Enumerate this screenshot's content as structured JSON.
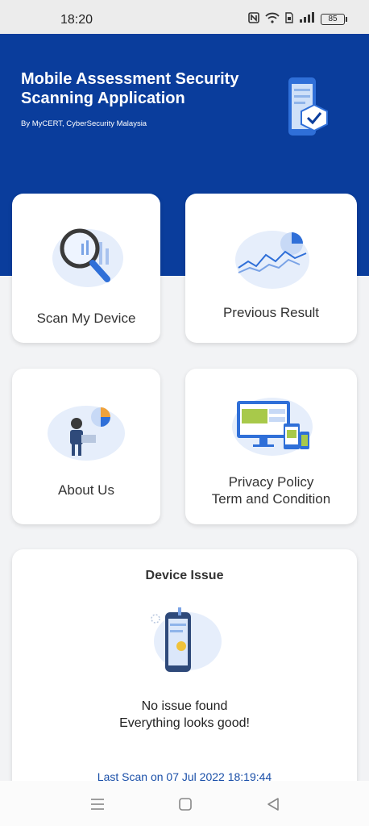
{
  "status_bar": {
    "time": "18:20",
    "battery": "85",
    "icons": [
      "nfc-icon",
      "wifi-icon",
      "sim-icon",
      "signal-icon",
      "battery-icon"
    ]
  },
  "header": {
    "title_line1": "Mobile Assessment Security",
    "title_line2": "Scanning Application",
    "subtitle": "By MyCERT, CyberSecurity Malaysia"
  },
  "menu": {
    "scan": "Scan My Device",
    "previous": "Previous Result",
    "about": "About Us",
    "privacy_line1": "Privacy Policy",
    "privacy_line2": "Term and Condition"
  },
  "device_issue": {
    "title": "Device Issue",
    "message_line1": "No issue found",
    "message_line2": "Everything looks good!",
    "last_scan": "Last Scan on 07 Jul 2022 18:19:44"
  },
  "colors": {
    "brand_blue": "#0a3d9c",
    "link_blue": "#1a4fa8"
  }
}
